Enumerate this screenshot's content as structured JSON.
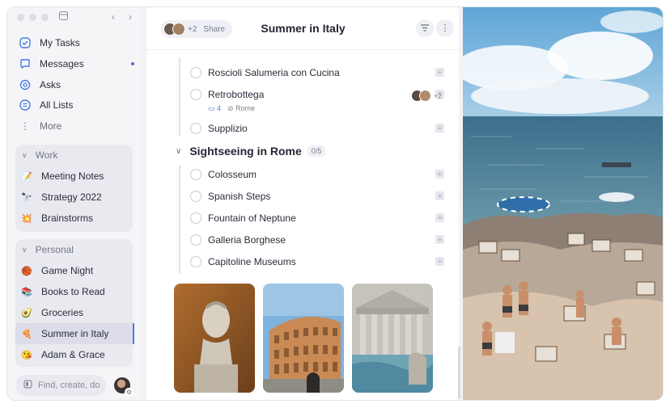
{
  "sidebar": {
    "nav": [
      {
        "label": "My Tasks",
        "icon": "check-circle-icon"
      },
      {
        "label": "Messages",
        "icon": "chat-bubble-icon"
      },
      {
        "label": "Asks",
        "icon": "at-sign-icon"
      },
      {
        "label": "All Lists",
        "icon": "list-icon"
      },
      {
        "label": "More",
        "icon": "more-vertical-icon"
      }
    ],
    "groups": {
      "work": {
        "title": "Work",
        "items": [
          {
            "label": "Meeting Notes",
            "emoji": "📝"
          },
          {
            "label": "Strategy 2022",
            "emoji": "🔭"
          },
          {
            "label": "Brainstorms",
            "emoji": "💥"
          }
        ]
      },
      "personal": {
        "title": "Personal",
        "items": [
          {
            "label": "Game Night",
            "emoji": "🏀"
          },
          {
            "label": "Books to Read",
            "emoji": "📚"
          },
          {
            "label": "Groceries",
            "emoji": "🥑"
          },
          {
            "label": "Summer in Italy",
            "emoji": "🍕"
          },
          {
            "label": "Adam & Grace",
            "emoji": "😘"
          }
        ]
      }
    },
    "search_placeholder": "Find, create, do"
  },
  "header": {
    "title": "Summer in Italy",
    "share_label": "Share",
    "share_count": "+2"
  },
  "tasks_above": [
    {
      "label": "Roscioli Salumeria con Cucina"
    },
    {
      "label": "Retrobottega",
      "comments": "4",
      "tag": "Rome",
      "assignee_count": "+2"
    },
    {
      "label": "Supplizio"
    }
  ],
  "section": {
    "title": "Sightseeing in Rome",
    "count": "0/5",
    "tasks": [
      {
        "label": "Colosseum"
      },
      {
        "label": "Spanish Steps"
      },
      {
        "label": "Fountain of Neptune"
      },
      {
        "label": "Galleria Borghese"
      },
      {
        "label": "Capitoline Museums"
      }
    ]
  },
  "colors": {
    "accent": "#4a7be8",
    "sidebar_bg": "#f5f5f8",
    "group_bg": "#e9e9f0"
  }
}
